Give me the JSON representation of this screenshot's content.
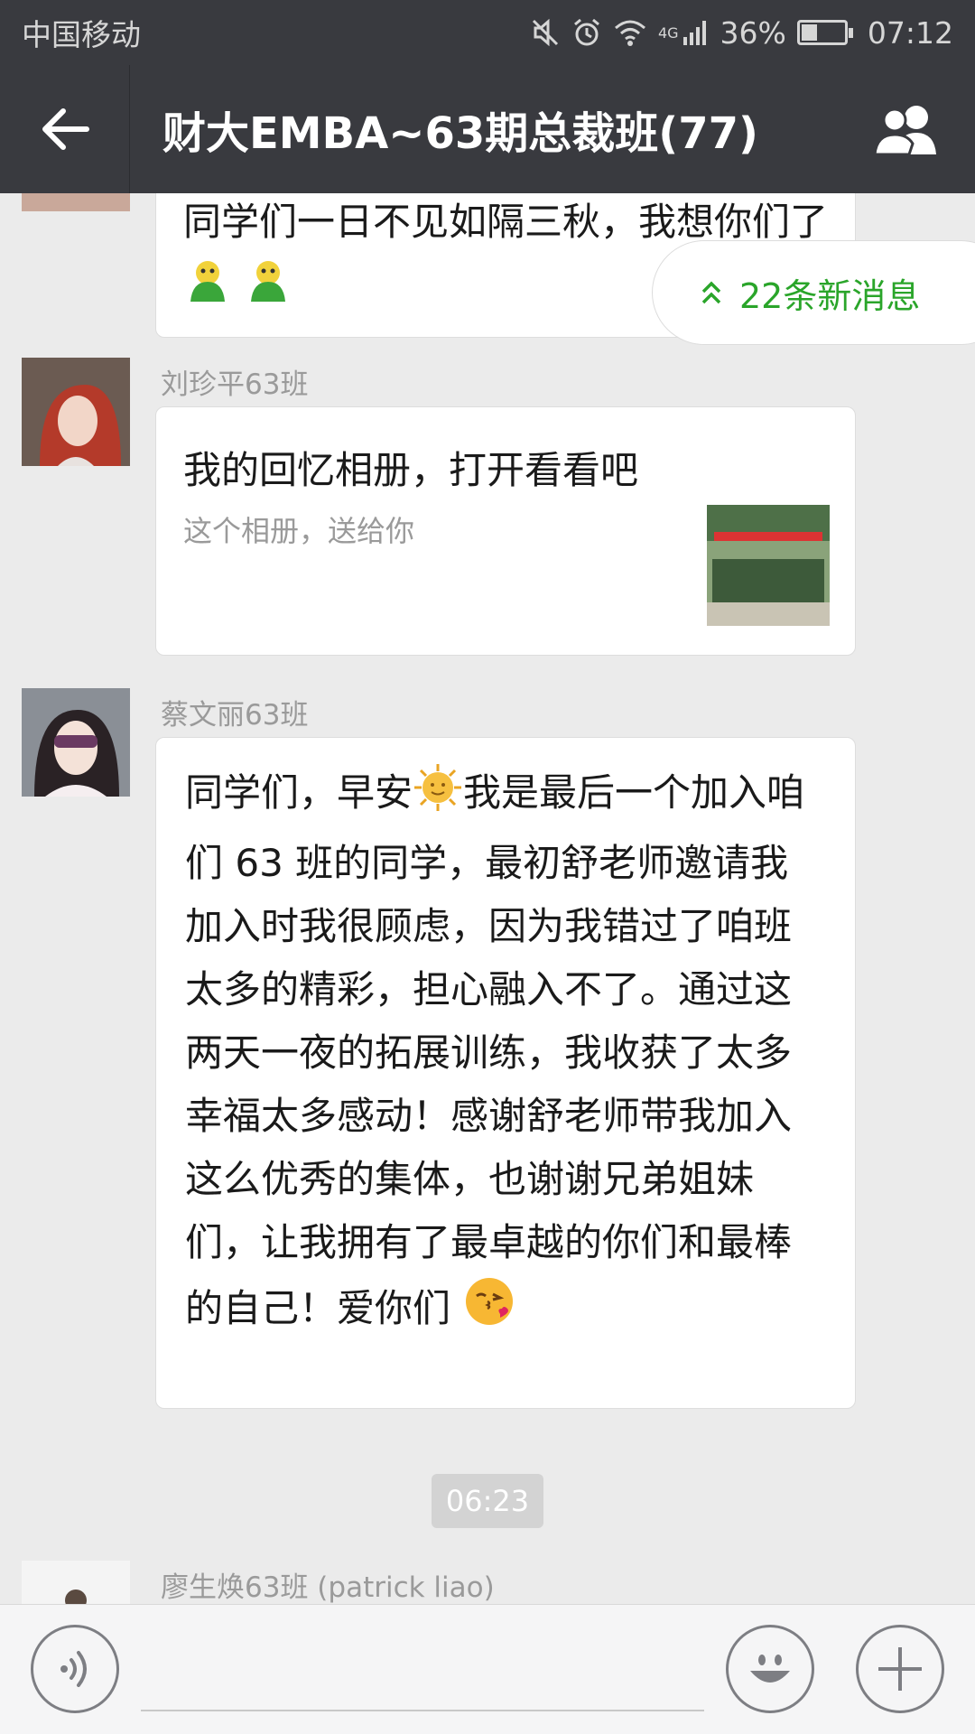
{
  "status_bar": {
    "carrier": "中国移动",
    "network": "4G",
    "battery_percent": "36%",
    "battery_level": 0.36,
    "time": "07:12",
    "icons": [
      "mute-icon",
      "alarm-icon",
      "wifi-icon",
      "signal-icon",
      "battery-icon"
    ]
  },
  "nav": {
    "title": "财大EMBA~63期总裁班(77)",
    "back_icon": "back-arrow-icon",
    "members_icon": "group-members-icon"
  },
  "new_messages": {
    "label": "22条新消息",
    "icon": "double-chevron-up-icon",
    "color": "#2aa52a"
  },
  "messages": [
    {
      "text": "同学们一日不见如隔三秋，我想你们了",
      "emoji": [
        "green-figure-emoji",
        "green-figure-emoji"
      ]
    },
    {
      "sender": "刘珍平63班",
      "type": "album",
      "title": "我的回忆相册，打开看看吧",
      "description": "这个相册，送给你"
    },
    {
      "sender": "蔡文丽63班",
      "text_before_emoji": "同学们，早安",
      "text_after_emoji": "我是最后一个加入咱们 63 班的同学，最初舒老师邀请我加入时我很顾虑，因为我错过了咱班太多的精彩，担心融入不了。通过这两天一夜的拓展训练，我收获了太多幸福太多感动！感谢舒老师带我加入这么优秀的集体，也谢谢兄弟姐妹们，让我拥有了最卓越的你们和最棒的自己！爱你们",
      "emoji": [
        "sun-emoji",
        "kiss-emoji"
      ]
    },
    {
      "sender": "廖生焕63班 (patrick liao)"
    }
  ],
  "time_divider": "06:23",
  "input_bar": {
    "voice_icon": "voice-icon",
    "emoji_icon": "emoji-smile-icon",
    "plus_icon": "plus-icon"
  }
}
